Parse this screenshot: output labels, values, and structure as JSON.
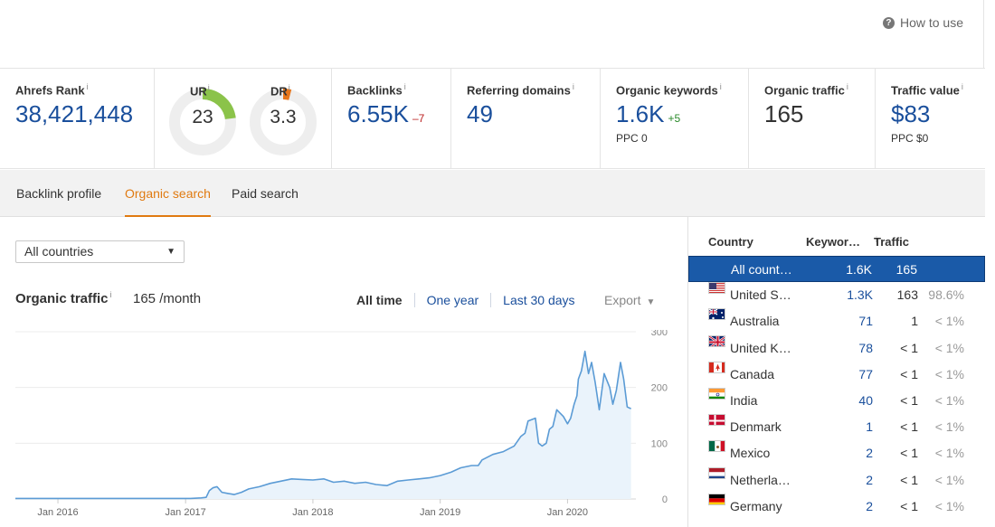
{
  "header": {
    "how_to_use": "How to use"
  },
  "metrics": {
    "ahrefs_rank": {
      "label": "Ahrefs Rank",
      "info": "i",
      "value": "38,421,448"
    },
    "ur": {
      "label": "UR",
      "info": "i",
      "value": "23",
      "level": 23,
      "color": "#8bc34a"
    },
    "dr": {
      "label": "DR",
      "info": "i",
      "value": "3.3",
      "level": 3.3,
      "color": "#e8761a"
    },
    "backlinks": {
      "label": "Backlinks",
      "info": "i",
      "value": "6.55K",
      "delta": "–7"
    },
    "referring_domains": {
      "label": "Referring domains",
      "info": "i",
      "value": "49"
    },
    "organic_keywords": {
      "label": "Organic keywords",
      "info": "i",
      "value": "1.6K",
      "delta": "+5",
      "sub": "PPC 0"
    },
    "organic_traffic": {
      "label": "Organic traffic",
      "info": "i",
      "value": "165"
    },
    "traffic_value": {
      "label": "Traffic value",
      "info": "i",
      "value": "$83",
      "sub": "PPC $0"
    }
  },
  "tabs": [
    {
      "label": "Backlink profile",
      "active": false
    },
    {
      "label": "Organic search",
      "active": true
    },
    {
      "label": "Paid search",
      "active": false
    }
  ],
  "filter": {
    "country_select": "All countries"
  },
  "chart_header": {
    "title": "Organic traffic",
    "info": "i",
    "subtitle": "165 /month",
    "ranges": [
      "All time",
      "One year",
      "Last 30 days"
    ],
    "selected_range": "All time",
    "export_label": "Export"
  },
  "chart_data": {
    "type": "area",
    "title": "Organic traffic",
    "xlabel": "",
    "ylabel": "",
    "x_ticks": [
      "Jan 2016",
      "Jan 2017",
      "Jan 2018",
      "Jan 2019",
      "Jan 2020"
    ],
    "y_ticks": [
      0,
      100,
      200,
      300
    ],
    "ylim": [
      0,
      300
    ],
    "xlim": [
      "2015-09-01",
      "2020-07-15"
    ],
    "grid": true,
    "line_color": "#5b9bd5",
    "fill_color": "#eaf3fb",
    "series": [
      {
        "x": [
          "2015-09-01",
          "2016-01-01",
          "2016-06-01",
          "2016-12-01",
          "2017-01-15",
          "2017-02-15",
          "2017-03-01",
          "2017-03-10",
          "2017-03-20",
          "2017-04-01",
          "2017-04-15",
          "2017-05-01",
          "2017-05-20",
          "2017-06-10",
          "2017-07-01",
          "2017-08-01",
          "2017-09-01",
          "2017-10-01",
          "2017-11-01",
          "2017-12-01",
          "2018-01-01",
          "2018-02-01",
          "2018-03-01",
          "2018-04-01",
          "2018-05-01",
          "2018-06-01",
          "2018-07-01",
          "2018-08-01",
          "2018-09-01",
          "2018-10-01",
          "2018-11-01",
          "2018-12-01",
          "2019-01-01",
          "2019-02-01",
          "2019-03-01",
          "2019-04-01",
          "2019-04-20",
          "2019-05-01",
          "2019-06-01",
          "2019-07-01",
          "2019-08-01",
          "2019-08-20",
          "2019-09-01",
          "2019-09-10",
          "2019-10-01",
          "2019-10-10",
          "2019-10-20",
          "2019-11-01",
          "2019-11-10",
          "2019-11-20",
          "2019-12-01",
          "2019-12-20",
          "2020-01-01",
          "2020-01-10",
          "2020-01-20",
          "2020-01-28",
          "2020-02-01",
          "2020-02-10",
          "2020-02-20",
          "2020-03-01",
          "2020-03-10",
          "2020-03-20",
          "2020-04-01",
          "2020-04-15",
          "2020-05-01",
          "2020-05-10",
          "2020-05-20",
          "2020-06-01",
          "2020-06-10",
          "2020-06-20",
          "2020-07-01"
        ],
        "y": [
          1,
          1,
          1,
          1,
          1,
          2,
          3,
          15,
          20,
          22,
          12,
          10,
          8,
          12,
          18,
          22,
          28,
          32,
          36,
          35,
          34,
          36,
          30,
          32,
          28,
          30,
          26,
          24,
          32,
          34,
          36,
          38,
          42,
          48,
          56,
          60,
          60,
          70,
          80,
          85,
          95,
          112,
          118,
          140,
          145,
          100,
          95,
          100,
          125,
          130,
          160,
          148,
          135,
          145,
          170,
          185,
          215,
          230,
          265,
          225,
          245,
          210,
          160,
          225,
          200,
          170,
          195,
          245,
          215,
          165,
          162
        ]
      }
    ]
  },
  "country_table": {
    "headers": {
      "country": "Country",
      "keywords": "Keywor…",
      "traffic": "Traffic",
      "traffic_info": "i"
    },
    "rows": [
      {
        "flag": "none",
        "name": "All count…",
        "keywords": "1.6K",
        "traffic": "165",
        "share": "",
        "selected": true
      },
      {
        "flag": "us",
        "name": "United S…",
        "keywords": "1.3K",
        "traffic": "163",
        "share": "98.6%",
        "selected": false
      },
      {
        "flag": "au",
        "name": "Australia",
        "keywords": "71",
        "traffic": "1",
        "share": "< 1%",
        "selected": false
      },
      {
        "flag": "gb",
        "name": "United K…",
        "keywords": "78",
        "traffic": "< 1",
        "share": "< 1%",
        "selected": false
      },
      {
        "flag": "ca",
        "name": "Canada",
        "keywords": "77",
        "traffic": "< 1",
        "share": "< 1%",
        "selected": false
      },
      {
        "flag": "in",
        "name": "India",
        "keywords": "40",
        "traffic": "< 1",
        "share": "< 1%",
        "selected": false
      },
      {
        "flag": "dk",
        "name": "Denmark",
        "keywords": "1",
        "traffic": "< 1",
        "share": "< 1%",
        "selected": false
      },
      {
        "flag": "mx",
        "name": "Mexico",
        "keywords": "2",
        "traffic": "< 1",
        "share": "< 1%",
        "selected": false
      },
      {
        "flag": "nl",
        "name": "Netherla…",
        "keywords": "2",
        "traffic": "< 1",
        "share": "< 1%",
        "selected": false
      },
      {
        "flag": "de",
        "name": "Germany",
        "keywords": "2",
        "traffic": "< 1",
        "share": "< 1%",
        "selected": false
      }
    ]
  }
}
